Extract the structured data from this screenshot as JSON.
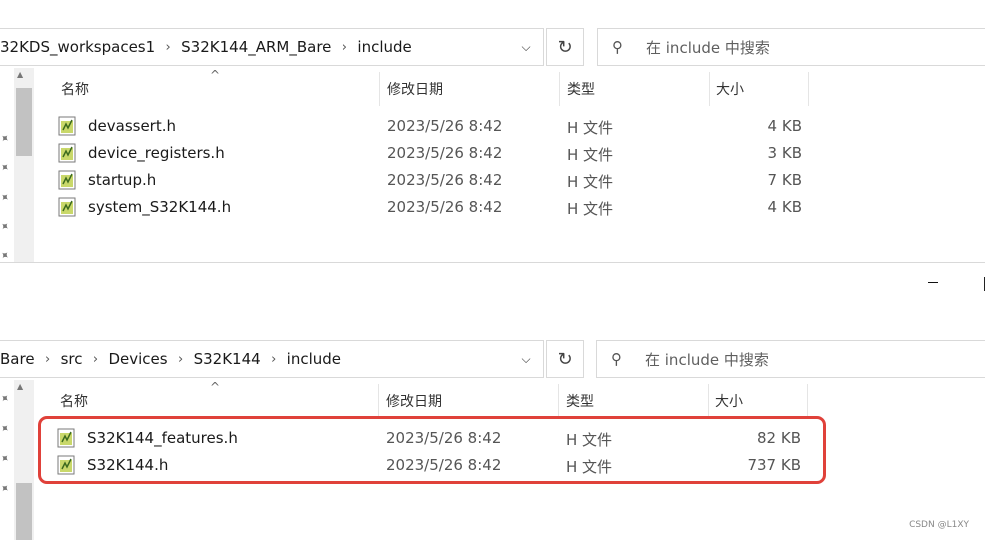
{
  "window1": {
    "breadcrumbs": [
      "32KDS_workspaces1",
      "S32K144_ARM_Bare",
      "include"
    ],
    "search_placeholder": "在 include 中搜索",
    "columns": {
      "name": "名称",
      "date": "修改日期",
      "type": "类型",
      "size": "大小"
    },
    "files": [
      {
        "name": "devassert.h",
        "date": "2023/5/26 8:42",
        "type": "H 文件",
        "size": "4 KB"
      },
      {
        "name": "device_registers.h",
        "date": "2023/5/26 8:42",
        "type": "H 文件",
        "size": "3 KB"
      },
      {
        "name": "startup.h",
        "date": "2023/5/26 8:42",
        "type": "H 文件",
        "size": "7 KB"
      },
      {
        "name": "system_S32K144.h",
        "date": "2023/5/26 8:42",
        "type": "H 文件",
        "size": "4 KB"
      }
    ]
  },
  "window2": {
    "breadcrumbs": [
      "Bare",
      "src",
      "Devices",
      "S32K144",
      "include"
    ],
    "search_placeholder": "在 include 中搜索",
    "columns": {
      "name": "名称",
      "date": "修改日期",
      "type": "类型",
      "size": "大小"
    },
    "files": [
      {
        "name": "S32K144_features.h",
        "date": "2023/5/26 8:42",
        "type": "H 文件",
        "size": "82 KB"
      },
      {
        "name": "S32K144.h",
        "date": "2023/5/26 8:42",
        "type": "H 文件",
        "size": "737 KB"
      }
    ]
  },
  "highlight_color": "#e0413a",
  "watermark": "CSDN @L1XY"
}
